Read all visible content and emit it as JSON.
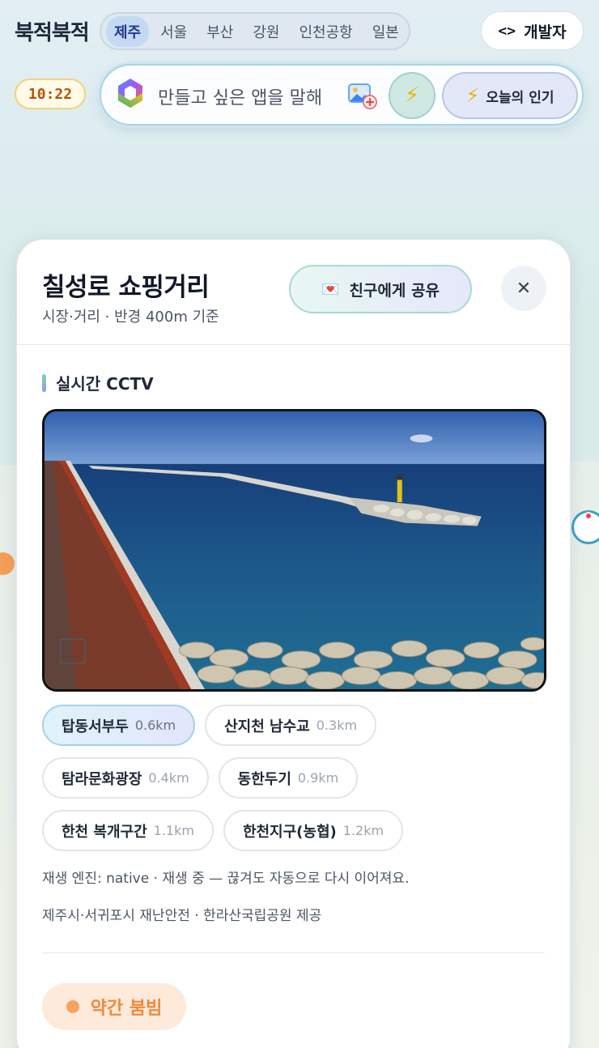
{
  "header": {
    "logo": "북적북적",
    "regions": [
      "제주",
      "서울",
      "부산",
      "강원",
      "인천공항",
      "일본"
    ],
    "active_region": "제주",
    "dev_label": "개발자",
    "dev_icon": "code-icon"
  },
  "clock": "10:22",
  "prompt": {
    "placeholder": "만들고 싶은 앱을 말해",
    "popular_label": "오늘의 인기"
  },
  "card": {
    "title": "칠성로 쇼핑거리",
    "subtitle": "시장·거리 · 반경 400m 기준",
    "share_label": "친구에게 공유",
    "close_icon": "close-icon",
    "section_title": "실시간 CCTV",
    "cameras": [
      {
        "name": "탑동서부두",
        "dist": "0.6km",
        "active": true
      },
      {
        "name": "산지천 남수교",
        "dist": "0.3km",
        "active": false
      },
      {
        "name": "탐라문화광장",
        "dist": "0.4km",
        "active": false
      },
      {
        "name": "동한두기",
        "dist": "0.9km",
        "active": false
      },
      {
        "name": "한천 복개구간",
        "dist": "1.1km",
        "active": false
      },
      {
        "name": "한천지구(농협)",
        "dist": "1.2km",
        "active": false
      }
    ],
    "playback_info": "재생 엔진: native · 재생 중 — 끊겨도 자동으로 다시 이어져요.",
    "provider_info": "제주시·서귀포시 재난안전 · 한라산국립공원 제공",
    "status_label": "약간 붐빔",
    "status_color": "#f08a3c"
  }
}
